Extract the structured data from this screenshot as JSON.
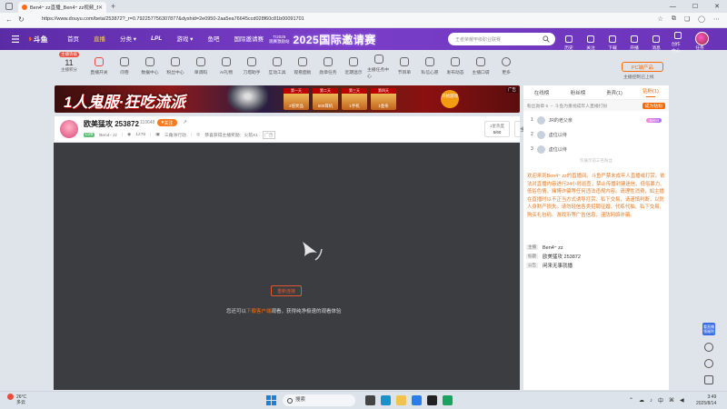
{
  "browser": {
    "tab_title": "Ben4ｰ zz直播_Ben4ｰ zz视频_Be",
    "url": "https://www.douyu.com/beta/253872?_r=0.792257756307877&dyshid=2e0950-2aa5ea76645ccd028f60c81b00091701"
  },
  "header": {
    "logo_text": "斗鱼",
    "nav": [
      "首页",
      "直播",
      "分类",
      "LPL",
      "游戏",
      "鱼吧",
      "国际邀请赛"
    ],
    "active_nav": "直播",
    "promo_small_top": "TI2025",
    "promo_small_bottom": "观赛激励站",
    "promo_title": "2025国际邀请赛",
    "search_placeholder": "王者荣耀甲级职业联赛",
    "icons": [
      "历史",
      "关注",
      "下载",
      "开播",
      "消息",
      "创作中心",
      "任务"
    ]
  },
  "toolbar": {
    "level_label": "主播等级",
    "level_value": "11",
    "level_sub": "主播积分",
    "items": [
      "直播开关",
      "问卷",
      "数据中心",
      "粉丝中心",
      "单调码",
      "AI礼物",
      "刀塔助手",
      "互动工具",
      "观看面板",
      "勋章任务",
      "近期温示",
      "主播任务中心",
      "节目单",
      "私信心愿",
      "发布动态",
      "主播口袋",
      "更多"
    ],
    "pc_button": "PC端产品",
    "pc_sub": "主播控制已上线"
  },
  "banner": {
    "title": "1人鬼服·狂吃流派",
    "cards": [
      {
        "top": "第一天",
        "bottom": "2倍奖品"
      },
      {
        "top": "第二天",
        "bottom": "500耳机"
      },
      {
        "top": "第三天",
        "bottom": "1手机"
      },
      {
        "top": "第四天",
        "bottom": "1金条"
      }
    ],
    "start_text": "开始游戏",
    "ad_label": "广告"
  },
  "streamer": {
    "name": "欧美猛攻 253872",
    "fans": "110648",
    "follow_label": "关注",
    "level_tag": "LV8",
    "nickname": "Ben4ｰ zz",
    "heat": "1278",
    "category": "三角洲行动",
    "activity": "恭喜获得主播奖励：火箭X1",
    "ad_tag": "广告",
    "viewers_label": "1星热度",
    "viewers_value": "5/60",
    "fullscreen_label": "全站榜",
    "gold_label": "猜猜你喜欢"
  },
  "player": {
    "retry_label": "重新连接",
    "tip_prefix": "您还可以",
    "tip_link": "下载客户端",
    "tip_suffix": "观看，获得纯净极速的观看体验"
  },
  "chat": {
    "tabs": [
      "在线榜",
      "粉丝榜",
      "贵宾(1)",
      "钻粉(1)"
    ],
    "active_tab": "钻粉(1)",
    "fan_row_text": "粉丝勋章 5 ・ 斗鱼为重视成年人直播打扮",
    "gift_label": "成为钻粉",
    "rank": [
      {
        "name": "JR的老父亲",
        "badge": "Ben4"
      },
      {
        "name": "虚位以待",
        "badge": ""
      },
      {
        "name": "虚位以待",
        "badge": ""
      }
    ],
    "rank_note": "仅展示前三名粉丝",
    "notice": "欢迎来到Ben4ｰ zz的直播间。斗鱼严禁未成年人直播或打赏。依法对直播内容进行24小时巡查，禁止传播封建迷信、低俗暴力、低俗色情、赌博诈骗等任何违法违规内容。请理性消费，如主播在直播时以不正当方式诱导打赏、私下交易，请谨慎判断，以防人身财产损失。请勿轻信各类招聘征婚、代练代抽、私下交易、购买礼包码、游戏币等广告信息，谨防网络诈骗。",
    "info": [
      {
        "k": "主播",
        "v": "Ben4ｰ zz"
      },
      {
        "k": "标题",
        "v": "欧美猛攻 253872"
      },
      {
        "k": "公告",
        "v": "闲来无事就播"
      }
    ]
  },
  "rail": {
    "badge": "看直播领福利"
  },
  "taskbar": {
    "temp": "26°C",
    "weather": "多云",
    "search": "搜索",
    "time": "3:49",
    "date": "2025/8/14",
    "lang": "中"
  },
  "colors": {
    "brand_purple": "#6a34b8",
    "accent_orange": "#ff6a00",
    "player_bg": "#3c3d41"
  }
}
